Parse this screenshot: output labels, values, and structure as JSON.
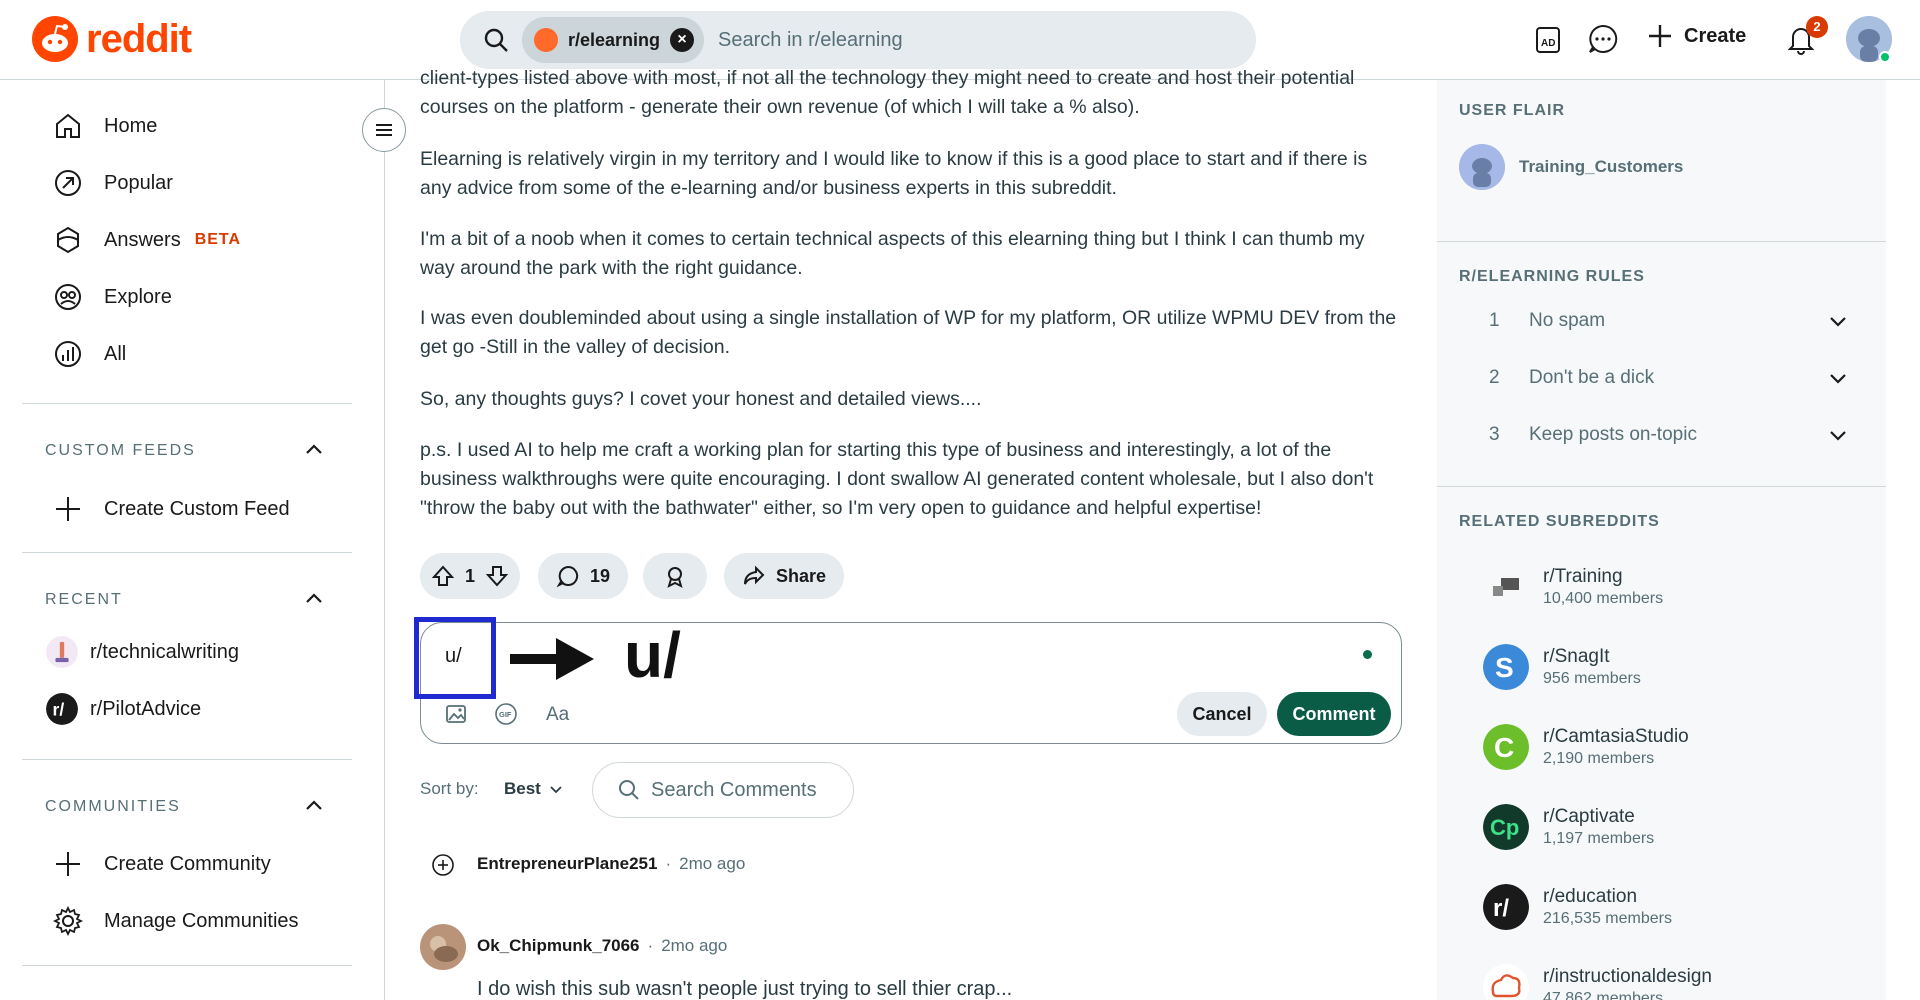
{
  "header": {
    "brand": "reddit",
    "search_chip": "r/elearning",
    "search_placeholder": "Search in r/elearning",
    "create_label": "Create",
    "notification_count": "2"
  },
  "sidebar": {
    "nav": [
      {
        "label": "Home",
        "icon": "home-icon"
      },
      {
        "label": "Popular",
        "icon": "popular-icon"
      },
      {
        "label": "Answers",
        "icon": "answers-icon",
        "badge": "BETA"
      },
      {
        "label": "Explore",
        "icon": "explore-icon"
      },
      {
        "label": "All",
        "icon": "all-icon"
      }
    ],
    "custom_feeds": {
      "title": "CUSTOM FEEDS",
      "create_label": "Create Custom Feed"
    },
    "recent": {
      "title": "RECENT",
      "items": [
        {
          "label": "r/technicalwriting"
        },
        {
          "label": "r/PilotAdvice"
        }
      ]
    },
    "communities": {
      "title": "COMMUNITIES",
      "create_label": "Create Community",
      "manage_label": "Manage Communities"
    }
  },
  "post": {
    "paragraphs": [
      "client-types listed above with most, if not all the technology they might need to create and host their potential courses on the platform - generate their own revenue (of which I will take a % also).",
      "Elearning is relatively virgin in my territory and I would like to know if this is a good place to start and if there is any advice from some of the e-learning and/or business experts in this subreddit.",
      "I'm a bit of a noob when it comes to certain technical aspects of this elearning thing but I think I can thumb my way around the park with the right guidance.",
      "I was even doubleminded about using a single installation of WP for my platform, OR utilize WPMU DEV from the get go -Still in the valley of decision.",
      "So, any thoughts guys? I covet your honest and detailed views....",
      "p.s. I used AI to help me craft a working plan for starting this type of business and interestingly, a lot of the business walkthroughs were quite encouraging. I dont swallow AI generated content wholesale, but I also don't \"throw the baby out with the bathwater\" either, so I'm very open to guidance and helpful expertise!"
    ],
    "votes": "1",
    "comments": "19",
    "share_label": "Share"
  },
  "comment_box": {
    "typed": "u/",
    "annotation": "u/",
    "cancel_label": "Cancel",
    "submit_label": "Comment",
    "format_label": "Aa"
  },
  "sort": {
    "label": "Sort by:",
    "value": "Best",
    "search_placeholder": "Search Comments"
  },
  "comments": [
    {
      "user": "EntrepreneurPlane251",
      "time": "2mo ago"
    },
    {
      "user": "Ok_Chipmunk_7066",
      "time": "2mo ago",
      "body": "I do wish this sub wasn't people just trying to sell thier crap..."
    }
  ],
  "right": {
    "flair_title": "USER FLAIR",
    "flair_name": "Training_Customers",
    "rules_title": "R/ELEARNING RULES",
    "rules": [
      {
        "num": "1",
        "text": "No spam"
      },
      {
        "num": "2",
        "text": "Don't be a dick"
      },
      {
        "num": "3",
        "text": "Keep posts on-topic"
      }
    ],
    "related_title": "RELATED SUBREDDITS",
    "related": [
      {
        "name": "r/Training",
        "members": "10,400 members"
      },
      {
        "name": "r/SnagIt",
        "members": "956 members"
      },
      {
        "name": "r/CamtasiaStudio",
        "members": "2,190 members"
      },
      {
        "name": "r/Captivate",
        "members": "1,197 members"
      },
      {
        "name": "r/education",
        "members": "216,535 members"
      },
      {
        "name": "r/instructionaldesign",
        "members": "47,862 members"
      }
    ]
  },
  "colors": {
    "brand": "#ff4500",
    "comment_button": "#0a5c46",
    "highlight": "#1f2ad1"
  }
}
